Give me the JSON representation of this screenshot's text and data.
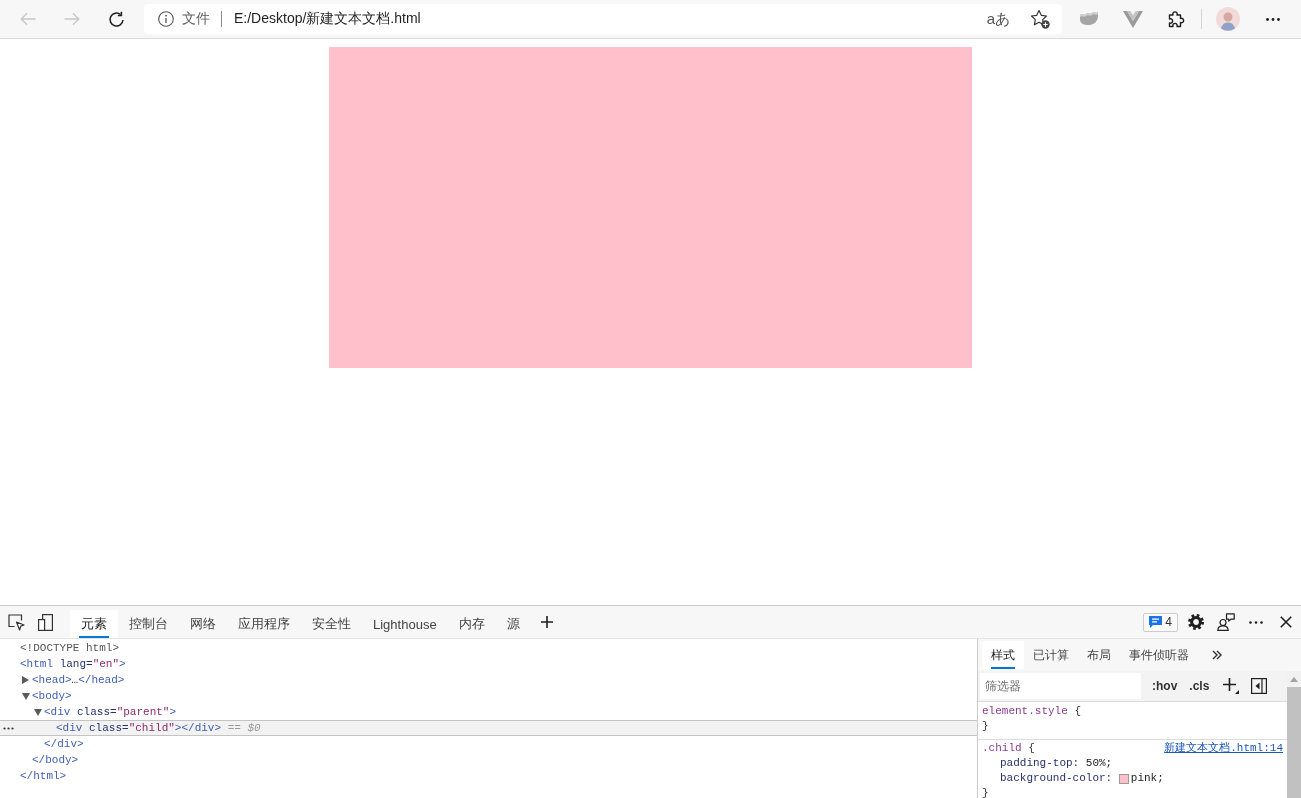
{
  "browser": {
    "nav_buttons": [
      {
        "kind": "back",
        "disabled": true
      },
      {
        "kind": "forward",
        "disabled": true
      },
      {
        "kind": "refresh",
        "disabled": false
      }
    ],
    "address_bar": {
      "security_label": "文件",
      "url": "E:/Desktop/新建文本文档.html",
      "translate": "aあ"
    }
  },
  "devtools": {
    "tabs": [
      {
        "label": "元素",
        "selected": true
      },
      {
        "label": "控制台",
        "selected": false
      },
      {
        "label": "网络",
        "selected": false
      },
      {
        "label": "应用程序",
        "selected": false
      },
      {
        "label": "安全性",
        "selected": false
      },
      {
        "label": "Lighthouse",
        "selected": false
      },
      {
        "label": "内存",
        "selected": false
      },
      {
        "label": "源",
        "selected": false
      }
    ],
    "issues_count": "4",
    "dom_tree": [
      {
        "tokens": [
          {
            "kind": "doctype",
            "text": "<!DOCTYPE html>"
          }
        ],
        "selected": false
      },
      {
        "tokens": [
          {
            "kind": "tag",
            "text": "<html"
          },
          {
            "kind": "attr",
            "text": "lang"
          },
          {
            "kind": "punct",
            "text": "="
          },
          {
            "kind": "value",
            "text": "\"en\""
          },
          {
            "kind": "tag",
            "text": ">"
          }
        ],
        "selected": false,
        "children": [
          {
            "tokens": [
              {
                "kind": "tag",
                "text": "<head>"
              },
              {
                "kind": "text",
                "text": "…"
              },
              {
                "kind": "tag",
                "text": "</head>"
              }
            ],
            "expanded": false,
            "selected": false
          },
          {
            "tokens": [
              {
                "kind": "tag",
                "text": "<body>"
              }
            ],
            "expanded": true,
            "selected": false,
            "children": [
              {
                "tokens": [
                  {
                    "kind": "tag",
                    "text": "<div"
                  },
                  {
                    "kind": "attr",
                    "text": "class"
                  },
                  {
                    "kind": "punct",
                    "text": "="
                  },
                  {
                    "kind": "value",
                    "text": "\"parent\""
                  },
                  {
                    "kind": "tag",
                    "text": ">"
                  }
                ],
                "expanded": true,
                "selected": false,
                "children": [
                  {
                    "tokens": [
                      {
                        "kind": "tag",
                        "text": "<div"
                      },
                      {
                        "kind": "attr",
                        "text": "class"
                      },
                      {
                        "kind": "punct",
                        "text": "="
                      },
                      {
                        "kind": "value",
                        "text": "\"child\""
                      },
                      {
                        "kind": "tag",
                        "text": "></div>"
                      }
                    ],
                    "selected": true,
                    "note": "== $0"
                  }
                ],
                "closing": [
                  {
                    "kind": "tag",
                    "text": "</div>"
                  }
                ]
              }
            ],
            "closing": [
              {
                "kind": "tag",
                "text": "</body>"
              }
            ]
          }
        ],
        "closing": [
          {
            "kind": "tag",
            "text": "</html>"
          }
        ]
      }
    ],
    "styles": {
      "tabs": [
        {
          "label": "样式",
          "selected": true
        },
        {
          "label": "已计算",
          "selected": false
        },
        {
          "label": "布局",
          "selected": false
        },
        {
          "label": "事件侦听器",
          "selected": false
        }
      ],
      "filter": {
        "placeholder": "筛选器"
      },
      "toggles": [
        ":hov",
        ".cls"
      ],
      "rules": [
        {
          "selector": "element.style",
          "brace": "{",
          "close": "}"
        },
        {
          "selector": ".child",
          "brace": "{",
          "source": "新建文本文档.html:14",
          "properties": [
            {
              "name": "padding-top:",
              "value": "50%;"
            },
            {
              "name": "background-color:",
              "value": "pink;",
              "color": "#ffc0cb"
            }
          ],
          "close": "}"
        }
      ]
    }
  }
}
